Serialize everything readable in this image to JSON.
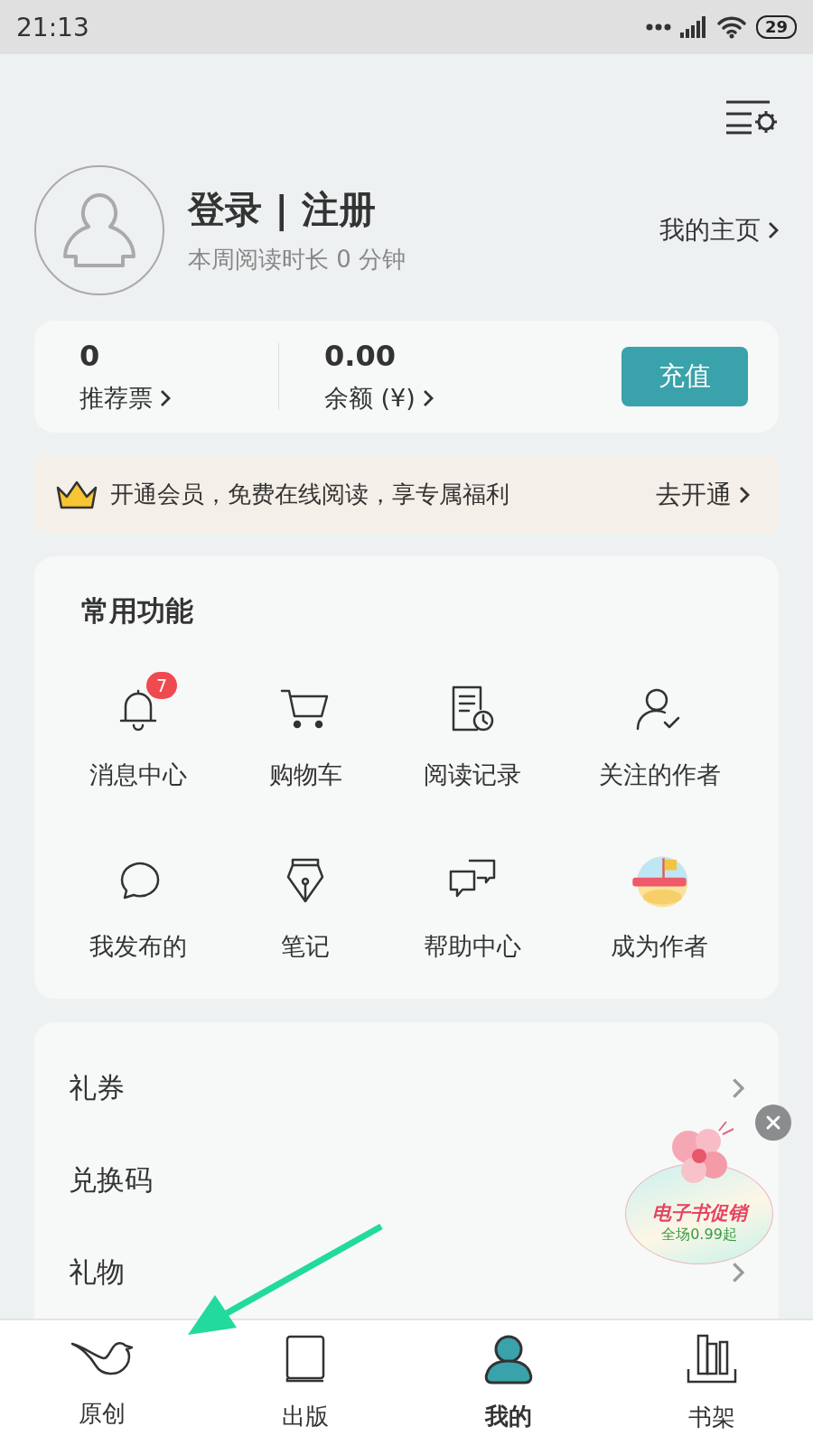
{
  "status_bar": {
    "time": "21:13",
    "battery": "29"
  },
  "profile": {
    "title": "登录 | 注册",
    "subtitle": "本周阅读时长 0 分钟",
    "homepage_link": "我的主页"
  },
  "stats": {
    "items": [
      {
        "value": "0",
        "label": "推荐票"
      },
      {
        "value": "0.00",
        "label": "余额 (¥)"
      }
    ],
    "recharge_button": "充值"
  },
  "vip_banner": {
    "text": "开通会员，免费在线阅读，享专属福利",
    "action": "去开通"
  },
  "functions": {
    "title": "常用功能",
    "items": [
      {
        "label": "消息中心",
        "badge": "7"
      },
      {
        "label": "购物车"
      },
      {
        "label": "阅读记录"
      },
      {
        "label": "关注的作者"
      },
      {
        "label": "我发布的"
      },
      {
        "label": "笔记"
      },
      {
        "label": "帮助中心"
      },
      {
        "label": "成为作者"
      }
    ]
  },
  "list": [
    {
      "label": "礼券"
    },
    {
      "label": "兑换码"
    },
    {
      "label": "礼物"
    }
  ],
  "promo": {
    "title": "电子书促销",
    "subtitle": "全场0.99起"
  },
  "nav": [
    {
      "label": "原创",
      "selected": false
    },
    {
      "label": "出版",
      "selected": false
    },
    {
      "label": "我的",
      "selected": true
    },
    {
      "label": "书架",
      "selected": false
    }
  ]
}
